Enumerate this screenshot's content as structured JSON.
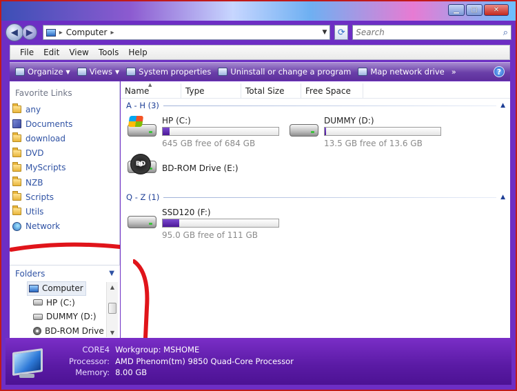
{
  "address": {
    "location": "Computer",
    "search_placeholder": "Search"
  },
  "menu": [
    "File",
    "Edit",
    "View",
    "Tools",
    "Help"
  ],
  "toolbar": {
    "organize": "Organize",
    "views": "Views",
    "system_properties": "System properties",
    "uninstall": "Uninstall or change a program",
    "map_drive": "Map network drive",
    "more": "»"
  },
  "favorites": {
    "header": "Favorite Links",
    "items": [
      {
        "label": "any",
        "icon": "folder-icon"
      },
      {
        "label": "Documents",
        "icon": "documents-icon"
      },
      {
        "label": "download",
        "icon": "folder-icon"
      },
      {
        "label": "DVD",
        "icon": "folder-icon"
      },
      {
        "label": "MyScripts",
        "icon": "folder-icon"
      },
      {
        "label": "NZB",
        "icon": "folder-icon"
      },
      {
        "label": "Scripts",
        "icon": "folder-icon"
      },
      {
        "label": "Utils",
        "icon": "folder-icon"
      },
      {
        "label": "Network",
        "icon": "network-icon"
      }
    ]
  },
  "folders": {
    "header": "Folders",
    "tree": [
      {
        "label": "Computer",
        "icon": "computer-icon"
      },
      {
        "label": "HP (C:)",
        "icon": "windows-drive-icon"
      },
      {
        "label": "DUMMY (D:)",
        "icon": "hard-drive-icon"
      },
      {
        "label": "BD-ROM Drive",
        "icon": "bd-rom-icon"
      }
    ]
  },
  "columns": [
    "Name",
    "Type",
    "Total Size",
    "Free Space"
  ],
  "groups": [
    {
      "label": "A - H (3)"
    },
    {
      "label": "Q - Z (1)"
    }
  ],
  "drives": [
    {
      "name": "HP (C:)",
      "free_text": "645 GB free of 684 GB",
      "used_fraction": 0.057
    },
    {
      "name": "DUMMY (D:)",
      "free_text": "13.5 GB free of 13.6 GB",
      "used_fraction": 0.01
    },
    {
      "name": "BD-ROM Drive (E:)"
    },
    {
      "name": "SSD120 (F:)",
      "free_text": "95.0 GB free of 111 GB",
      "used_fraction": 0.144
    }
  ],
  "details": {
    "computer_name": "CORE4",
    "workgroup_label": "Workgroup:",
    "workgroup": "MSHOME",
    "processor_label": "Processor:",
    "processor": "AMD Phenom(tm) 9850 Quad-Core Processor",
    "memory_label": "Memory:",
    "memory": "8.00 GB"
  },
  "colors": {
    "accent": "#6a2fb6",
    "annotation_red": "#e0141a",
    "link_blue": "#2f52a4"
  }
}
